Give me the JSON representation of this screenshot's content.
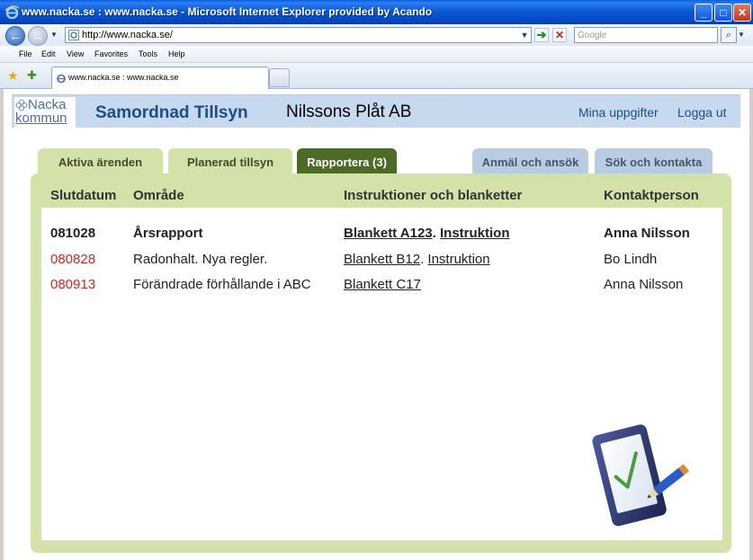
{
  "window": {
    "title": "www.nacka.se : www.nacka.se - Microsoft Internet Explorer provided by Acando",
    "min_label": "_",
    "max_label": "□",
    "close_label": "✕"
  },
  "address": {
    "url": "http://www.nacka.se/",
    "search_placeholder": "Google",
    "go_label": "➔",
    "stop_label": "✕",
    "search_label": "⌕"
  },
  "menu": {
    "items": [
      "File",
      "Edit",
      "View",
      "Favorites",
      "Tools",
      "Help"
    ]
  },
  "browser_tab": {
    "label": "www.nacka.se : www.nacka.se"
  },
  "header": {
    "logo_line1": "Nacka",
    "logo_line2": "kommun",
    "site_title": "Samordnad Tillsyn",
    "company": "Nilssons Plåt AB",
    "link_my_info": "Mina uppgifter",
    "link_logout": "Logga ut"
  },
  "tabs": [
    {
      "label": "Aktiva ärenden",
      "state": "inactive"
    },
    {
      "label": "Planerad tillsyn",
      "state": "inactive"
    },
    {
      "label": "Rapportera (3)",
      "state": "active"
    },
    {
      "label": "Anmäl och ansök",
      "state": "inactive"
    },
    {
      "label": "Sök och kontakta",
      "state": "inactive"
    }
  ],
  "table": {
    "headers": {
      "date": "Slutdatum",
      "area": "Område",
      "docs": "Instruktioner och blanketter",
      "contact": "Kontaktperson"
    },
    "rows": [
      {
        "date": "081028",
        "area": "Årsrapport",
        "form": "Blankett A123",
        "sep": ".",
        "instruction": "Instruktion",
        "contact": "Anna Nilsson"
      },
      {
        "date": "080828",
        "area": "Radonhalt. Nya regler.",
        "form": "Blankett B12",
        "sep": ".",
        "instruction": "Instruktion",
        "contact": "Bo Lindh"
      },
      {
        "date": "080913",
        "area": "Förändrade förhållande i ABC",
        "form": "Blankett C17",
        "sep": "",
        "instruction": "",
        "contact": "Anna Nilsson"
      }
    ]
  },
  "colors": {
    "titlebar": "#0a5fdd",
    "header_bg": "#c6d9ef",
    "panel_green": "#d3e2a8",
    "active_tab": "#4d6a27",
    "overdue_red": "#d9251c"
  },
  "icons": {
    "tablet": "tablet-checkmark-pen-icon"
  }
}
